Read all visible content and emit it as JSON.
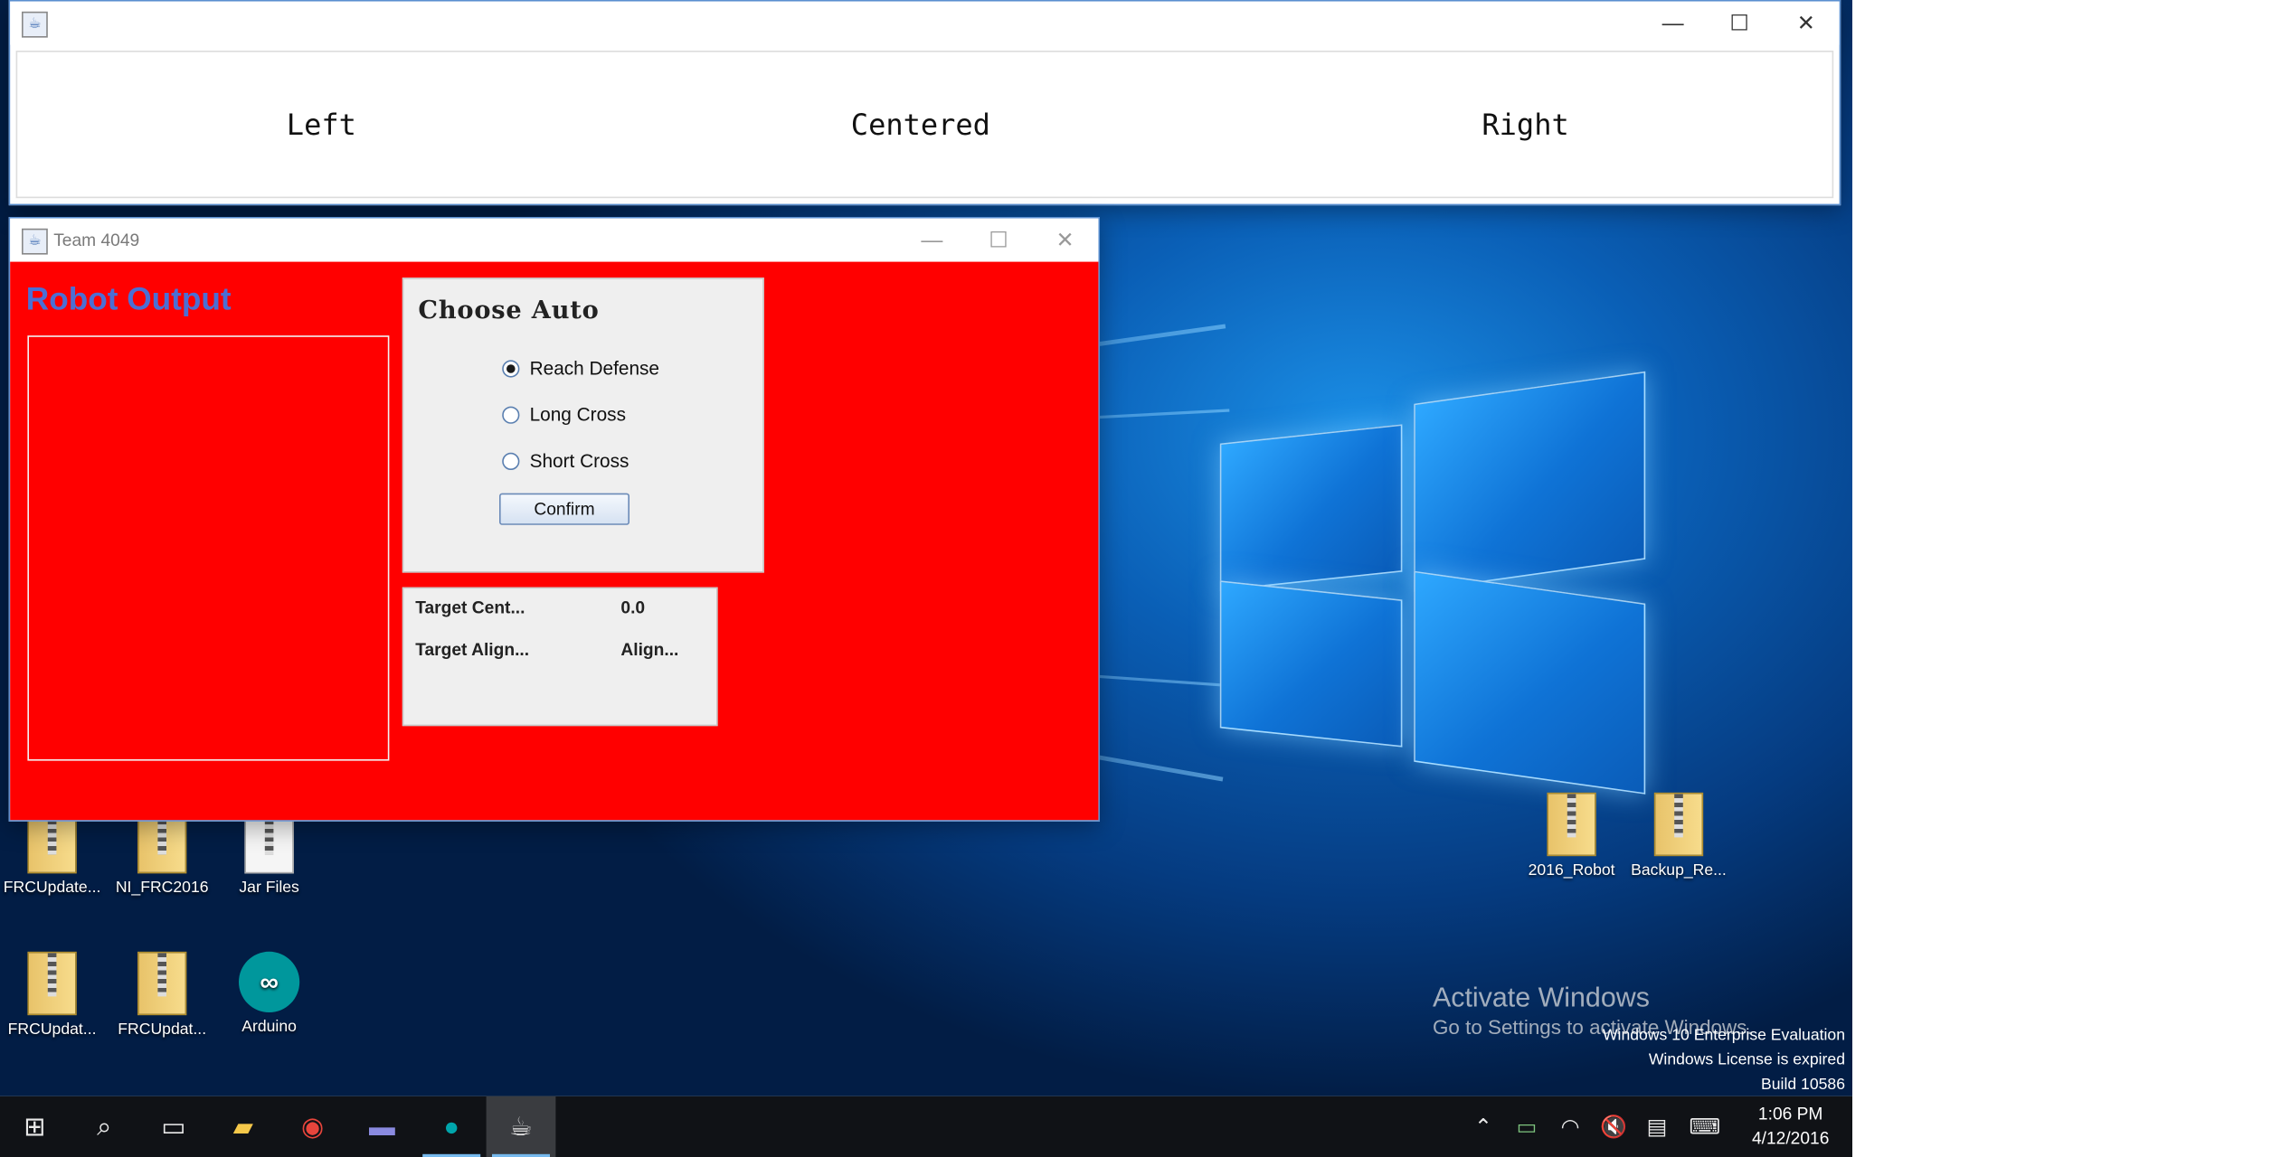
{
  "window_top": {
    "labels": [
      "Left",
      "Centered",
      "Right"
    ]
  },
  "window_main": {
    "title": "Team 4049",
    "robot_output_label": "Robot Output",
    "auto_panel": {
      "title": "Choose Auto",
      "options": [
        "Reach Defense",
        "Long Cross",
        "Short Cross"
      ],
      "selected": "Reach Defense",
      "confirm_label": "Confirm"
    },
    "table": [
      {
        "label": "Target Cent...",
        "value": "0.0"
      },
      {
        "label": "Target Align...",
        "value": "Align..."
      }
    ]
  },
  "desktop": {
    "icons": [
      {
        "label": "FRCUpdate..."
      },
      {
        "label": "NI_FRC2016"
      },
      {
        "label": "Jar Files"
      },
      {
        "label": "FRCUpdat..."
      },
      {
        "label": "FRCUpdat..."
      },
      {
        "label": "Arduino"
      },
      {
        "label": "2016_Robot"
      },
      {
        "label": "Backup_Re..."
      }
    ],
    "activate_title": "Activate Windows",
    "activate_sub": "Go to Settings to activate Windows.",
    "eval_lines": [
      "Windows 10 Enterprise Evaluation",
      "Windows License is expired",
      "Build 10586"
    ]
  },
  "taskbar": {
    "time": "1:06 PM",
    "date": "4/12/2016"
  }
}
